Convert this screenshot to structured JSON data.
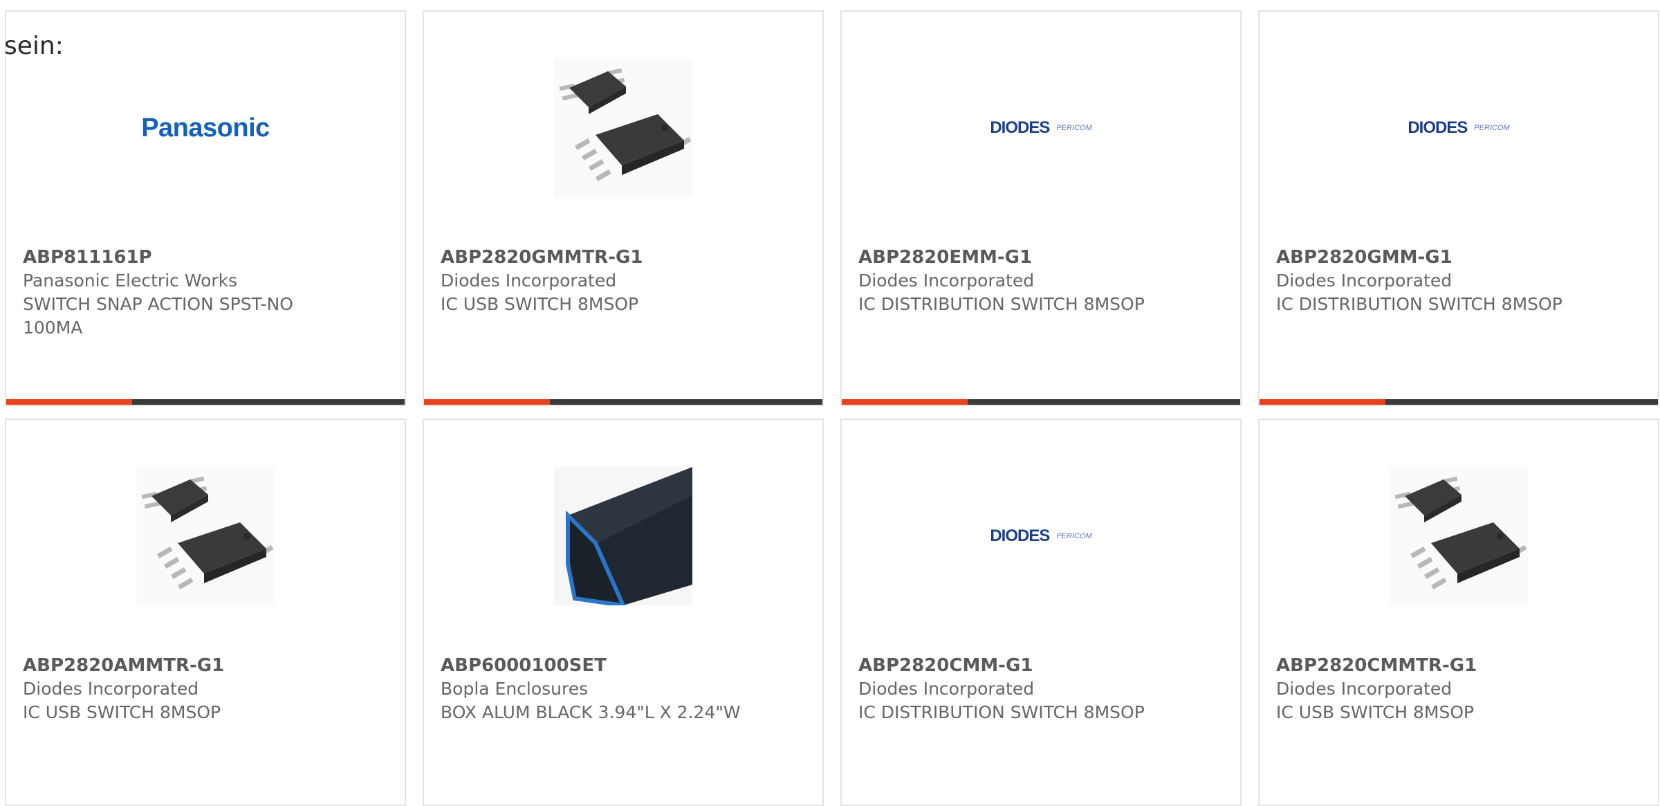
{
  "prefix": "sein:",
  "colors": {
    "accent": "#e8411c",
    "bar": "#3a3a3a",
    "border": "#e3e3e3"
  },
  "logo_text": {
    "panasonic": "Panasonic",
    "diodes": "DIODES",
    "pericom": "PERICOM"
  },
  "products": [
    {
      "part": "ABP811161P",
      "manufacturer": "Panasonic Electric Works",
      "description": "SWITCH SNAP ACTION SPST-NO 100MA",
      "image": "panasonic-logo"
    },
    {
      "part": "ABP2820GMMTR-G1",
      "manufacturer": "Diodes Incorporated",
      "description": "IC USB SWITCH 8MSOP",
      "image": "chip-photo"
    },
    {
      "part": "ABP2820EMM-G1",
      "manufacturer": "Diodes Incorporated",
      "description": "IC DISTRIBUTION SWITCH 8MSOP",
      "image": "diodes-logo"
    },
    {
      "part": "ABP2820GMM-G1",
      "manufacturer": "Diodes Incorporated",
      "description": "IC DISTRIBUTION SWITCH 8MSOP",
      "image": "diodes-logo"
    },
    {
      "part": "ABP2820AMMTR-G1",
      "manufacturer": "Diodes Incorporated",
      "description": "IC USB SWITCH 8MSOP",
      "image": "chip-photo"
    },
    {
      "part": "ABP6000100SET",
      "manufacturer": "Bopla Enclosures",
      "description": "BOX ALUM BLACK 3.94\"L X 2.24\"W",
      "image": "enclosure-photo"
    },
    {
      "part": "ABP2820CMM-G1",
      "manufacturer": "Diodes Incorporated",
      "description": "IC DISTRIBUTION SWITCH 8MSOP",
      "image": "diodes-logo"
    },
    {
      "part": "ABP2820CMMTR-G1",
      "manufacturer": "Diodes Incorporated",
      "description": "IC USB SWITCH 8MSOP",
      "image": "chip-photo"
    }
  ]
}
